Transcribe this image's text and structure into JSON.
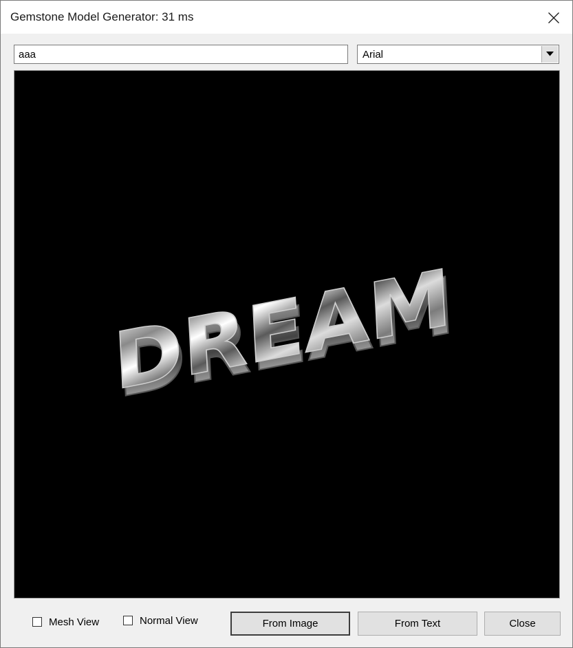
{
  "window": {
    "title": "Gemstone Model Generator: 31 ms"
  },
  "toolbar": {
    "text_value": "aaa",
    "font_selected": "Arial"
  },
  "viewport": {
    "background": "#000000",
    "rendered_text": "DREAM"
  },
  "options": {
    "mesh_view": {
      "label": "Mesh View",
      "checked": false
    },
    "normal_view": {
      "label": "Normal View",
      "checked": false
    }
  },
  "buttons": {
    "from_image": "From Image",
    "from_text": "From Text",
    "close": "Close"
  },
  "icons": {
    "close": "close-icon",
    "dropdown": "chevron-down-icon"
  }
}
